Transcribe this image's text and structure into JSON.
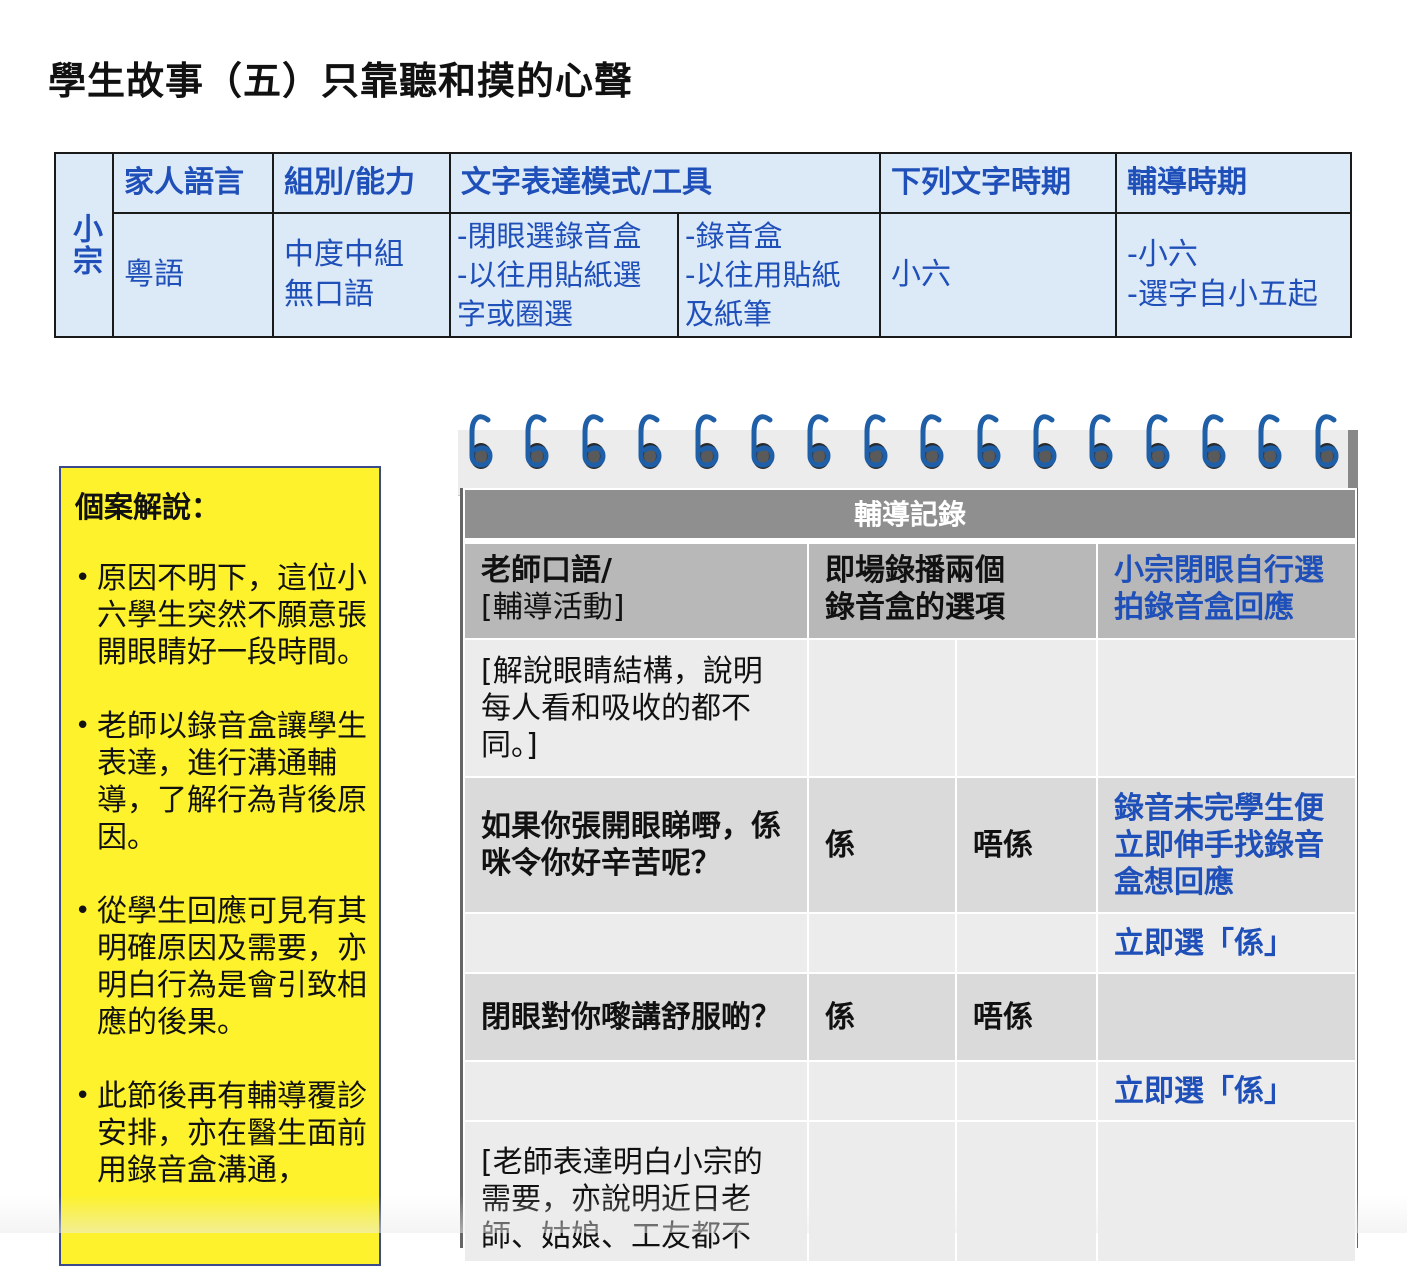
{
  "page": {
    "title": "學生故事（五）只靠聽和摸的心聲"
  },
  "info_table": {
    "student_name": "小宗",
    "headers": [
      "家人語言",
      "組別/能力",
      "文字表達模式/工具",
      "下列文字時期",
      "輔導時期"
    ],
    "row": {
      "language": "粵語",
      "group_line1": "中度中組",
      "group_line2": "無口語",
      "mode_a_line1": "-閉眼選錄音盒",
      "mode_a_line2": "-以往用貼紙選",
      "mode_a_line3": "字或圈選",
      "mode_b_line1": "-錄音盒",
      "mode_b_line2": "-以往用貼紙",
      "mode_b_line3": "及紙筆",
      "text_period": "小六",
      "counsel_line1": "-小六",
      "counsel_line2": "-選字自小五起"
    }
  },
  "case": {
    "heading": "個案解說：",
    "bullet_symbol": "•",
    "items": [
      "原因不明下，這位小六學生突然不願意張開眼睛好一段時間。",
      "老師以錄音盒讓學生表達，進行溝通輔導，了解行為背後原因。",
      "從學生回應可見有其明確原因及需要，亦明白行為是會引致相應的後果。",
      "此節後再有輔導覆診安排，亦在醫生面前用錄音盒溝通，"
    ]
  },
  "record": {
    "title": "輔導記錄",
    "col1_line1": "老師口語/",
    "col1_line2": "[輔導活動]",
    "col2_line1": "即場錄播兩個",
    "col2_line2": "錄音盒的選項",
    "col3": "小宗閉眼自行選拍錄音盒回應",
    "rows": [
      {
        "teacher": "[解說眼睛結構，說明每人看和吸收的都不同。]",
        "opt1": "",
        "opt2": "",
        "response": ""
      },
      {
        "teacher": "如果你張開眼睇嘢，係咪令你好辛苦呢？",
        "opt1": "係",
        "opt2": "唔係",
        "response": "錄音未完學生便立即伸手找錄音盒想回應"
      },
      {
        "teacher": "",
        "opt1": "",
        "opt2": "",
        "response": "立即選「係」"
      },
      {
        "teacher": "閉眼對你嚟講舒服啲？",
        "opt1": "係",
        "opt2": "唔係",
        "response": ""
      },
      {
        "teacher": "",
        "opt1": "",
        "opt2": "",
        "response": "立即選「係」"
      },
      {
        "teacher": "[老師表達明白小宗的需要，亦說明近日老師、姑娘、工友都不",
        "opt1": "",
        "opt2": "",
        "response": ""
      }
    ]
  },
  "colors": {
    "accent_blue": "#1f4fb8",
    "info_bg": "#dce9f7",
    "case_yellow": "#fdf22b",
    "ring_blue": "#1f5fa8",
    "header_gray": "#8f8f8f"
  },
  "icons": {
    "ring": "spiral-binding-ring-icon"
  }
}
